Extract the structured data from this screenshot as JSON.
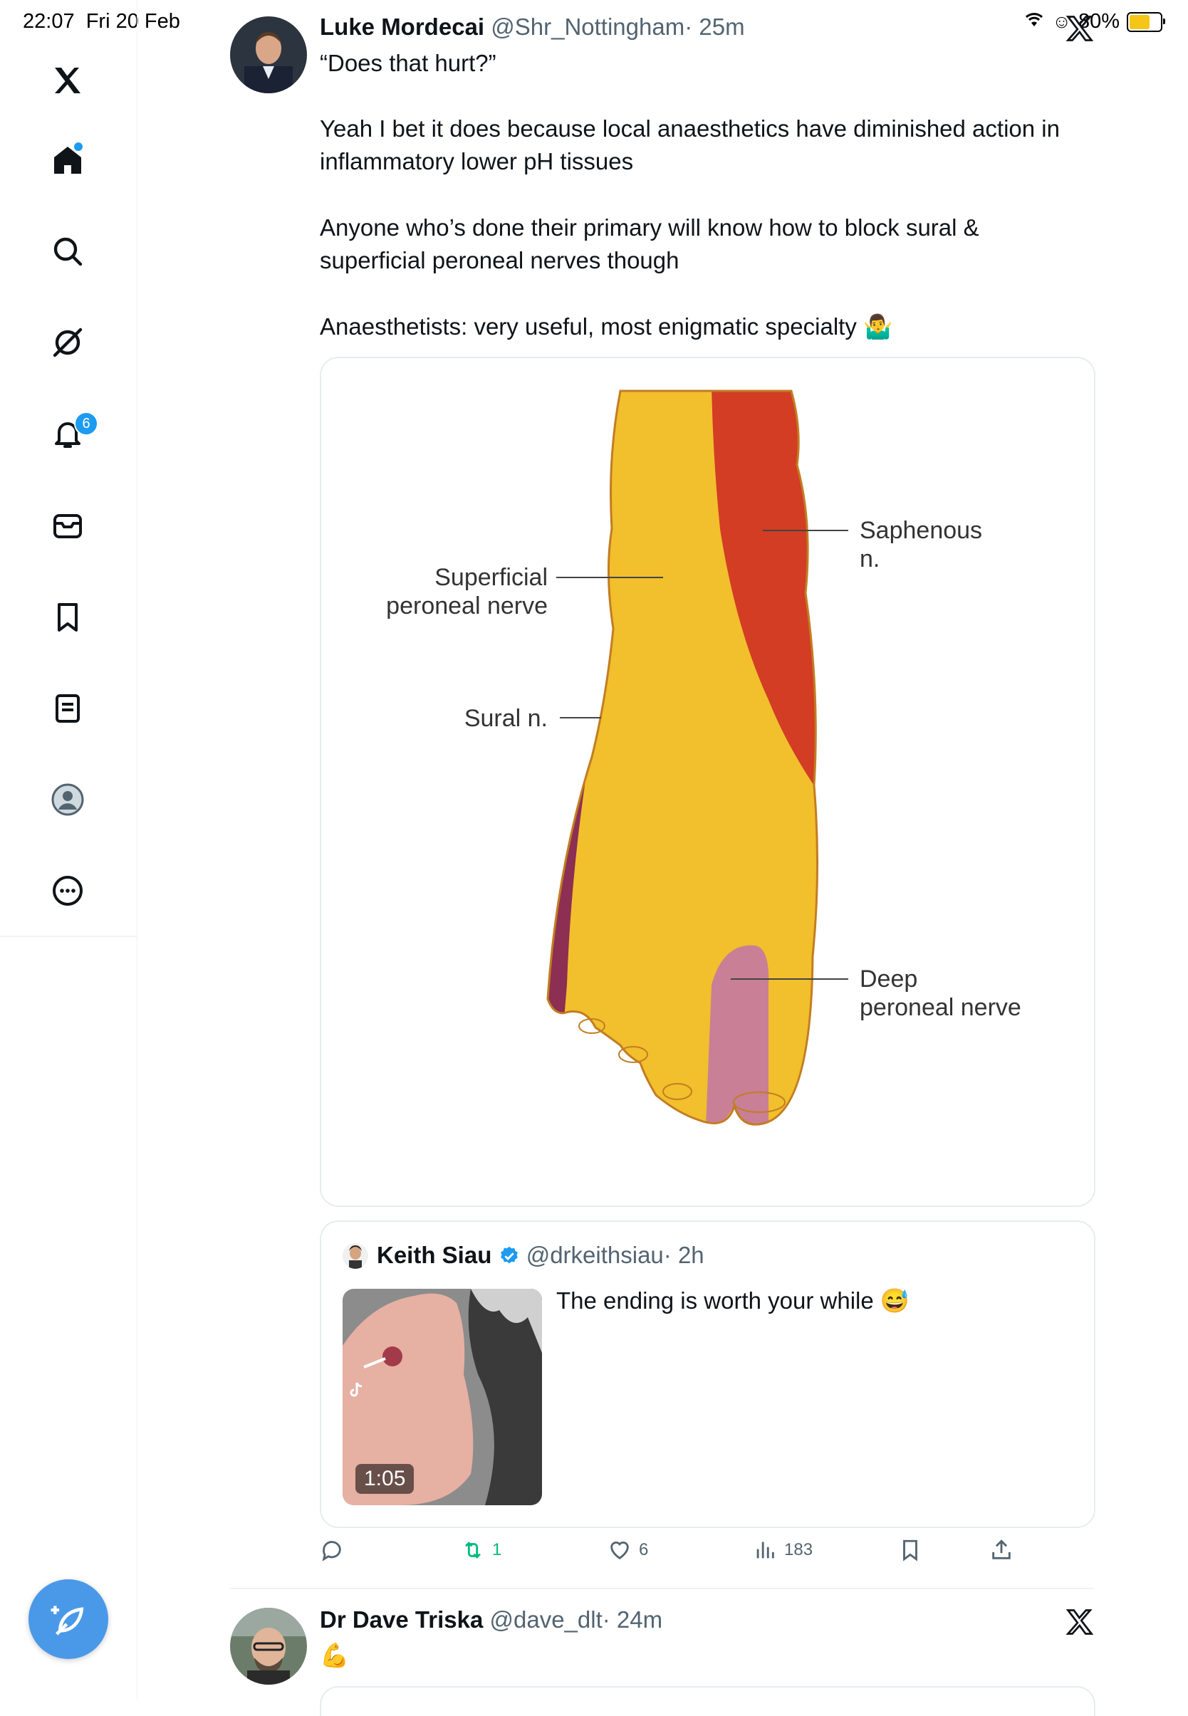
{
  "status_bar": {
    "time": "22:07",
    "date": "Fri 20 Feb",
    "battery": "80%"
  },
  "sidebar": {
    "items": [
      {
        "icon": "x-logo-icon"
      },
      {
        "icon": "home-icon"
      },
      {
        "icon": "search-icon"
      },
      {
        "icon": "grok-icon"
      },
      {
        "icon": "notifications-icon",
        "badge": "6"
      },
      {
        "icon": "messages-icon"
      },
      {
        "icon": "bookmarks-icon"
      },
      {
        "icon": "lists-icon"
      },
      {
        "icon": "profile-icon"
      },
      {
        "icon": "more-icon"
      }
    ],
    "compose_icon": "compose-icon"
  },
  "tweet": {
    "author_name": "Luke Mordecai",
    "author_handle": "@Shr_Nottingham",
    "time": "· 25m",
    "line1": "“Does that hurt?”",
    "line2": "Yeah I bet it does because local anaesthetics have diminished action in inflammatory lower pH tissues",
    "line3": "Anyone who’s done their primary will know how to block sural & superficial peroneal nerves though",
    "line4": "Anaesthetists: very useful, most enigmatic specialty 🤷‍♂️",
    "image": {
      "label_superficial": "Superficial\nperoneal nerve",
      "label_sural": "Sural n.",
      "label_saphenous": "Saphenous\nn.",
      "label_deep": "Deep\nperoneal nerve",
      "colors": {
        "superficial": "#f2bf2d",
        "saphenous": "#d23d24",
        "sural": "#8c2f52",
        "deep": "#c97f95"
      }
    },
    "quote": {
      "author_name": "Keith Siau",
      "author_handle": "@drkeithsiau",
      "time": "· 2h",
      "text": "The ending is worth your while 😅",
      "video_duration": "1:05",
      "verified_color": "#1d9bf0"
    },
    "actions": {
      "reply_count": "",
      "retweet_count": "1",
      "like_count": "6",
      "views_count": "183"
    }
  },
  "next_tweet": {
    "author_name": "Dr Dave Triska",
    "author_handle": "@dave_dlt",
    "time": "· 24m",
    "text": "💪"
  }
}
